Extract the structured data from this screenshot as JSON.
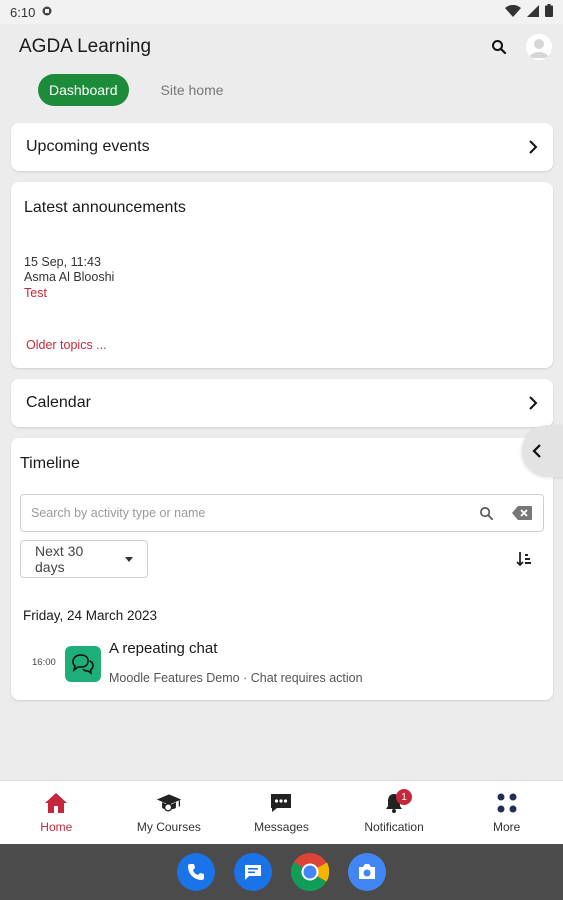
{
  "status": {
    "time": "6:10"
  },
  "app": {
    "title": "AGDA Learning"
  },
  "tabs": [
    {
      "label": "Dashboard",
      "active": true
    },
    {
      "label": "Site home",
      "active": false
    }
  ],
  "upcoming": {
    "title": "Upcoming events"
  },
  "announcements": {
    "title": "Latest announcements",
    "item": {
      "date": "15 Sep, 11:43",
      "author": "Asma Al Blooshi",
      "subject": "Test"
    },
    "older_link": "Older topics ..."
  },
  "calendar": {
    "title": "Calendar"
  },
  "timeline": {
    "title": "Timeline",
    "search_placeholder": "Search by activity type or name",
    "filter": "Next 30 days",
    "date_heading": "Friday, 24 March 2023",
    "event": {
      "time": "16:00",
      "name": "A repeating chat",
      "meta": "Moodle Features Demo · Chat requires action"
    }
  },
  "bottom_nav": [
    {
      "label": "Home",
      "icon": "home-icon",
      "active": true
    },
    {
      "label": "My Courses",
      "icon": "graduation-cap-icon"
    },
    {
      "label": "Messages",
      "icon": "chat-bubble-icon"
    },
    {
      "label": "Notification",
      "icon": "bell-icon",
      "badge": "1"
    },
    {
      "label": "More",
      "icon": "grid-dots-icon"
    }
  ],
  "dock": [
    "phone-app-icon",
    "messages-app-icon",
    "chrome-app-icon",
    "camera-app-icon"
  ],
  "colors": {
    "accent": "#1c8b3a",
    "brand_red": "#c5283d",
    "activity_green": "#1fae7a"
  }
}
